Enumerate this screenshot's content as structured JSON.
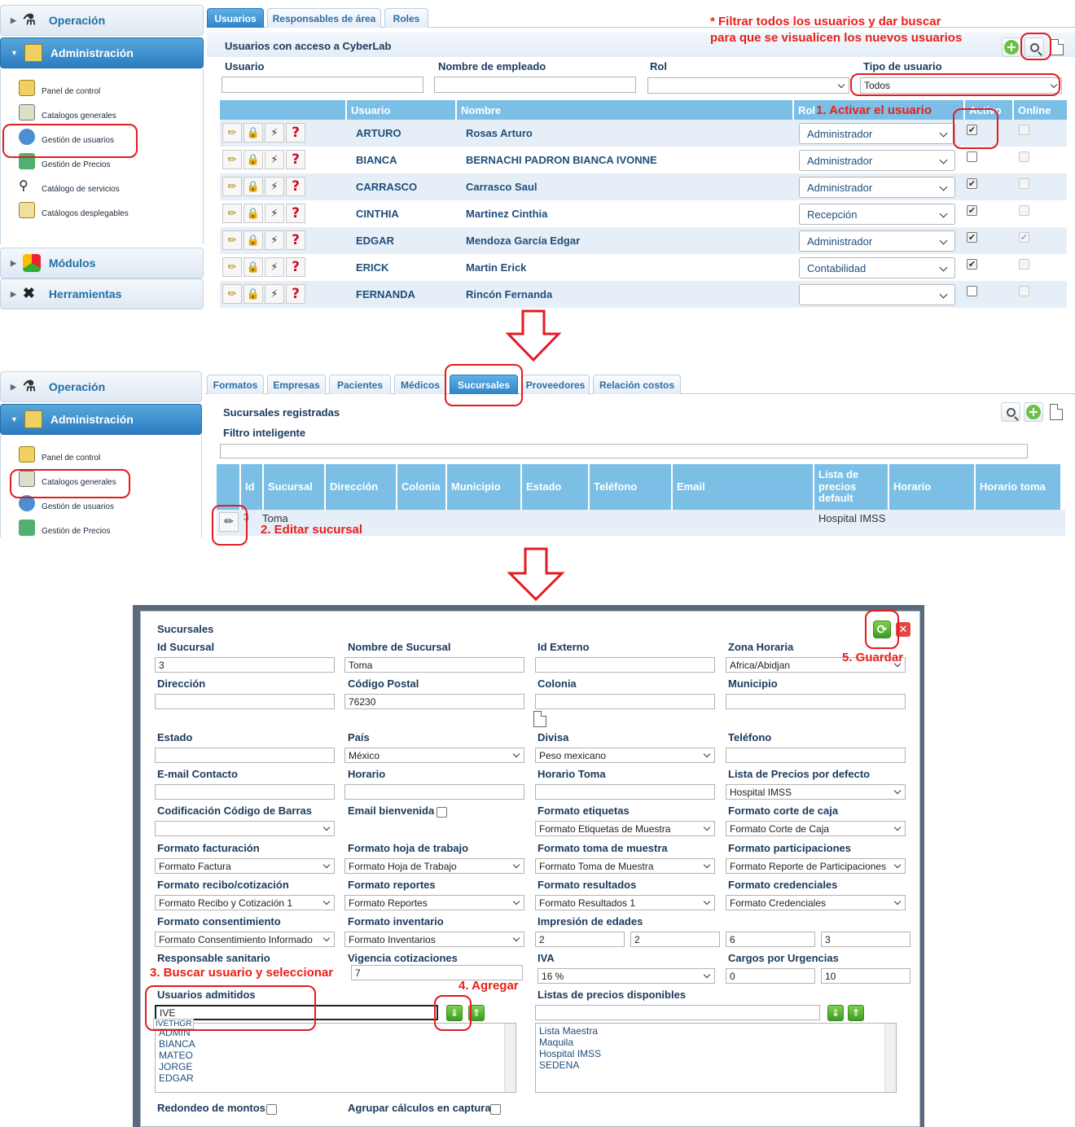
{
  "sidebar": {
    "operacion": "Operación",
    "administracion": "Administración",
    "modulos": "Módulos",
    "herramientas": "Herramientas",
    "items": [
      "Panel de control",
      "Catalogos generales",
      "Gestión de usuarios",
      "Gestión de Precios",
      "Catálogo de servicios",
      "Catálogos desplegables"
    ]
  },
  "users_panel": {
    "tabs": [
      "Usuarios",
      "Responsables de área",
      "Roles"
    ],
    "title": "Usuarios con acceso a CyberLab",
    "filters": {
      "usuario_label": "Usuario",
      "nombre_label": "Nombre de empleado",
      "rol_label": "Rol",
      "tipo_label": "Tipo de usuario",
      "tipo_value": "Todos"
    },
    "columns": [
      "Usuario",
      "Nombre",
      "Rol",
      "Activo",
      "Online"
    ],
    "rows": [
      {
        "usuario": "ARTURO",
        "nombre": "Rosas Arturo",
        "rol": "Administrador",
        "activo": true,
        "online": false
      },
      {
        "usuario": "BIANCA",
        "nombre": "BERNACHI PADRON BIANCA IVONNE",
        "rol": "Administrador",
        "activo": false,
        "online": false
      },
      {
        "usuario": "CARRASCO",
        "nombre": "Carrasco Saul",
        "rol": "Administrador",
        "activo": true,
        "online": false
      },
      {
        "usuario": "CINTHIA",
        "nombre": "Martinez Cinthia",
        "rol": "Recepción",
        "activo": true,
        "online": false
      },
      {
        "usuario": "EDGAR",
        "nombre": "Mendoza García Edgar",
        "rol": "Administrador",
        "activo": true,
        "online": true
      },
      {
        "usuario": "ERICK",
        "nombre": "Martin Erick",
        "rol": "Contabilidad",
        "activo": true,
        "online": false
      },
      {
        "usuario": "FERNANDA",
        "nombre": "Rincón Fernanda",
        "rol": "",
        "activo": false,
        "online": false
      }
    ]
  },
  "branches_panel": {
    "tabs": [
      "Formatos",
      "Empresas",
      "Pacientes",
      "Médicos",
      "Sucursales",
      "Proveedores",
      "Relación costos"
    ],
    "title": "Sucursales registradas",
    "filter_label": "Filtro inteligente",
    "columns": [
      "Id",
      "Sucursal",
      "Dirección",
      "Colonia",
      "Municipio",
      "Estado",
      "Teléfono",
      "Email",
      "Lista de precios default",
      "Horario",
      "Horario toma"
    ],
    "row": {
      "id": "3",
      "sucursal": "Toma",
      "lista": "Hospital IMSS"
    }
  },
  "modal": {
    "title": "Sucursales",
    "fields": {
      "id_sucursal": {
        "label": "Id Sucursal",
        "value": "3"
      },
      "nombre": {
        "label": "Nombre de Sucursal",
        "value": "Toma"
      },
      "id_externo": {
        "label": "Id Externo",
        "value": ""
      },
      "zona": {
        "label": "Zona Horaria",
        "value": "Africa/Abidjan"
      },
      "direccion": {
        "label": "Dirección",
        "value": ""
      },
      "cp": {
        "label": "Código Postal",
        "value": "76230"
      },
      "colonia": {
        "label": "Colonia",
        "value": ""
      },
      "municipio": {
        "label": "Municipio",
        "value": ""
      },
      "estado": {
        "label": "Estado",
        "value": ""
      },
      "pais": {
        "label": "País",
        "value": "México"
      },
      "divisa": {
        "label": "Divisa",
        "value": "Peso mexicano"
      },
      "telefono": {
        "label": "Teléfono",
        "value": ""
      },
      "email": {
        "label": "E-mail Contacto",
        "value": ""
      },
      "horario": {
        "label": "Horario",
        "value": ""
      },
      "horario_toma": {
        "label": "Horario Toma",
        "value": ""
      },
      "lista_precios": {
        "label": "Lista de Precios por defecto",
        "value": "Hospital IMSS"
      },
      "codificacion": {
        "label": "Codificación Código de Barras",
        "value": ""
      },
      "email_bienvenida": {
        "label": "Email bienvenida"
      },
      "formato_etiquetas": {
        "label": "Formato etiquetas",
        "value": "Formato Etiquetas de Muestra"
      },
      "formato_corte": {
        "label": "Formato corte de caja",
        "value": "Formato Corte de Caja"
      },
      "formato_facturacion": {
        "label": "Formato facturación",
        "value": "Formato Factura"
      },
      "formato_hoja": {
        "label": "Formato hoja de trabajo",
        "value": "Formato Hoja de Trabajo"
      },
      "formato_toma": {
        "label": "Formato toma de muestra",
        "value": "Formato Toma de Muestra"
      },
      "formato_participaciones": {
        "label": "Formato participaciones",
        "value": "Formato Reporte de Participaciones"
      },
      "formato_recibo": {
        "label": "Formato recibo/cotización",
        "value": "Formato Recibo y Cotización 1"
      },
      "formato_reportes": {
        "label": "Formato reportes",
        "value": "Formato Reportes"
      },
      "formato_resultados": {
        "label": "Formato resultados",
        "value": "Formato Resultados 1"
      },
      "formato_credenciales": {
        "label": "Formato credenciales",
        "value": "Formato Credenciales"
      },
      "formato_consentimiento": {
        "label": "Formato consentimiento",
        "value": "Formato Consentimiento Informado"
      },
      "formato_inventario": {
        "label": "Formato inventario",
        "value": "Formato Inventarios"
      },
      "impresion_edades": {
        "label": "Impresión de edades",
        "values": [
          "2",
          "2",
          "6",
          "3"
        ]
      },
      "responsable": {
        "label": "Responsable sanitario"
      },
      "vigencia": {
        "label": "Vigencia cotizaciones",
        "value": "7"
      },
      "iva": {
        "label": "IVA",
        "value": "16 %"
      },
      "cargos": {
        "label": "Cargos por Urgencias",
        "values": [
          "0",
          "10"
        ]
      },
      "usuarios": {
        "label": "Usuarios admitidos",
        "search": "IVE",
        "suggestion": "IVETHGR",
        "list": [
          "ADMIN",
          "BIANCA",
          "MATEO",
          "JORGE",
          "EDGAR"
        ]
      },
      "listas": {
        "label": "Listas de precios disponibles",
        "list": [
          "Lista Maestra",
          "Maquila",
          "Hospital IMSS",
          "SEDENA"
        ]
      },
      "redondeo": {
        "label": "Redondeo de montos"
      },
      "agrupar": {
        "label": "Agrupar cálculos en captura"
      }
    }
  },
  "annotations": {
    "filtrar_1": "* Filtrar  todos los usuarios y dar buscar",
    "filtrar_2": "para que se visualicen los nuevos usuarios",
    "step1": "1. Activar el usuario",
    "step2": "2. Editar sucursal",
    "step3": "3. Buscar usuario y seleccionar",
    "step4": "4. Agregar",
    "step5": "5. Guardar"
  },
  "colors": {
    "accent": "#2d84c8",
    "header": "#7cbfe6",
    "annotation": "#e31b23",
    "save": "#3f9a22"
  }
}
